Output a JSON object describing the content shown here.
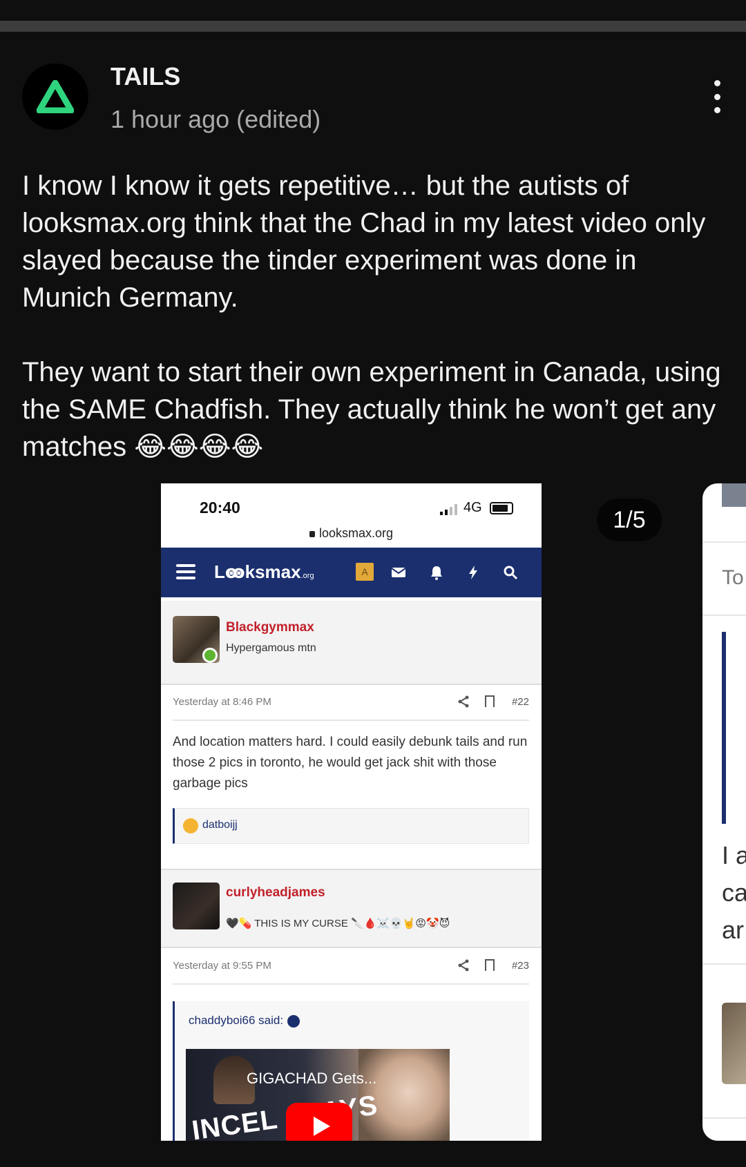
{
  "post": {
    "author": "TAILS",
    "time": "1 hour ago (edited)",
    "paragraph1": "I know I know it gets repetitive… but the autists of looksmax.org think that the Chad in my latest video only slayed because the tinder experiment was done in Munich Germany.",
    "paragraph2": "They want to start their own experiment in Canada, using the SAME Chadfish. They actually think he won’t get any matches 😂😂😂😂"
  },
  "carousel": {
    "counter": "1/5"
  },
  "screenshot": {
    "status": {
      "clock": "20:40",
      "network": "4G",
      "url": "looksmax.org"
    },
    "nav": {
      "logo": "Lꙭksmax",
      "logo_suffix": ".org",
      "badge": "A"
    },
    "post1": {
      "username": "Blackgymmax",
      "user_title": "Hypergamous mtn",
      "date": "Yesterday at 8:46 PM",
      "number": "#22",
      "text": "And location matters hard. I could easily debunk tails and run those 2 pics in toronto, he would get jack shit with those garbage pics",
      "reaction_user": "datboijj"
    },
    "post2": {
      "username": "curlyheadjames",
      "user_title": "🖤💊 THIS IS MY CURSE 🔪🩸☠️💀🤘😡🤡😈",
      "date": "Yesterday at 9:55 PM",
      "number": "#23",
      "quote_author": "chaddyboi66 said:",
      "video_title": "GIGACHAD Gets...",
      "video_overlay": "INCEL SLAYS"
    }
  },
  "next_card": {
    "text1": "To",
    "line1": "I a",
    "line2": "ca",
    "line3": "ar"
  },
  "colors": {
    "background": "#0f0f0f",
    "accent_green": "#2fd47e",
    "forum_navy": "#1b2f6e",
    "forum_red": "#c2202a"
  }
}
